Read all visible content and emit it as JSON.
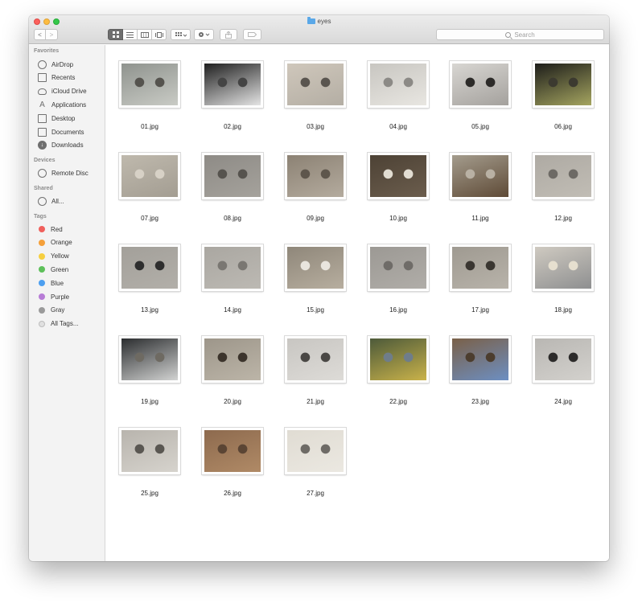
{
  "window": {
    "title": "eyes"
  },
  "toolbar": {
    "back_label": "<",
    "forward_label": ">",
    "search_placeholder": "Search"
  },
  "sidebar": {
    "favorites_heading": "Favorites",
    "favorites": [
      {
        "label": "AirDrop",
        "icon": "airdrop-icon"
      },
      {
        "label": "Recents",
        "icon": "recents-icon"
      },
      {
        "label": "iCloud Drive",
        "icon": "cloud-icon"
      },
      {
        "label": "Applications",
        "icon": "applications-icon"
      },
      {
        "label": "Desktop",
        "icon": "desktop-icon"
      },
      {
        "label": "Documents",
        "icon": "documents-icon"
      },
      {
        "label": "Downloads",
        "icon": "downloads-icon"
      }
    ],
    "devices_heading": "Devices",
    "devices": [
      {
        "label": "Remote Disc",
        "icon": "disc-icon"
      }
    ],
    "shared_heading": "Shared",
    "shared": [
      {
        "label": "All...",
        "icon": "globe-icon"
      }
    ],
    "tags_heading": "Tags",
    "tags": [
      {
        "label": "Red",
        "color": "#f0605c"
      },
      {
        "label": "Orange",
        "color": "#f5a03a"
      },
      {
        "label": "Yellow",
        "color": "#f6cf40"
      },
      {
        "label": "Green",
        "color": "#5dc05a"
      },
      {
        "label": "Blue",
        "color": "#4d9ff0"
      },
      {
        "label": "Purple",
        "color": "#b77cd6"
      },
      {
        "label": "Gray",
        "color": "#9a9a9a"
      },
      {
        "label": "All Tags...",
        "color": "#e0e0e0"
      }
    ]
  },
  "files": [
    {
      "name": "01.jpg",
      "colors": [
        "#8f938e",
        "#c9cbc5",
        "#55534e"
      ]
    },
    {
      "name": "02.jpg",
      "colors": [
        "#1f1f1f",
        "#e4e4e4",
        "#444"
      ]
    },
    {
      "name": "03.jpg",
      "colors": [
        "#cfc7bb",
        "#b4aea4",
        "#5a554f"
      ]
    },
    {
      "name": "04.jpg",
      "colors": [
        "#c8c6c1",
        "#e8e6e1",
        "#8c8a86"
      ]
    },
    {
      "name": "05.jpg",
      "colors": [
        "#d8d6d2",
        "#a4a19d",
        "#2d2b29"
      ]
    },
    {
      "name": "06.jpg",
      "colors": [
        "#1d1d1a",
        "#a5a560",
        "#3c3a30"
      ]
    },
    {
      "name": "07.jpg",
      "colors": [
        "#bfb9ad",
        "#a39d92",
        "#d7d1c6"
      ]
    },
    {
      "name": "08.jpg",
      "colors": [
        "#8e8b86",
        "#a5a29c",
        "#56534e"
      ]
    },
    {
      "name": "09.jpg",
      "colors": [
        "#8c8274",
        "#b4ab9e",
        "#5e564c"
      ]
    },
    {
      "name": "10.jpg",
      "colors": [
        "#4d4235",
        "#6b5d4d",
        "#e2ddd2"
      ]
    },
    {
      "name": "11.jpg",
      "colors": [
        "#a49c8d",
        "#5e4a36",
        "#b9b1a4"
      ]
    },
    {
      "name": "12.jpg",
      "colors": [
        "#aeaaa3",
        "#c1bdb5",
        "#6d6a65"
      ]
    },
    {
      "name": "13.jpg",
      "colors": [
        "#a3a09a",
        "#b2afa9",
        "#2e2e2e"
      ]
    },
    {
      "name": "14.jpg",
      "colors": [
        "#aaa7a1",
        "#bcb9b3",
        "#7a7772"
      ]
    },
    {
      "name": "15.jpg",
      "colors": [
        "#8f877a",
        "#b7ae9f",
        "#e9e5de"
      ]
    },
    {
      "name": "16.jpg",
      "colors": [
        "#9c9994",
        "#b0ada8",
        "#6f6c68"
      ]
    },
    {
      "name": "17.jpg",
      "colors": [
        "#9f9a91",
        "#b8b3aa",
        "#3a3631"
      ]
    },
    {
      "name": "18.jpg",
      "colors": [
        "#cfcac1",
        "#8e8f90",
        "#e6dfcf"
      ]
    },
    {
      "name": "19.jpg",
      "colors": [
        "#2b2d2f",
        "#d2d3d2",
        "#6e6a62"
      ]
    },
    {
      "name": "20.jpg",
      "colors": [
        "#9d968a",
        "#bcb5a8",
        "#3c342c"
      ]
    },
    {
      "name": "21.jpg",
      "colors": [
        "#c8c6c2",
        "#dddbd7",
        "#4a4845"
      ]
    },
    {
      "name": "22.jpg",
      "colors": [
        "#4d5a3a",
        "#c9b24a",
        "#6f7d8a"
      ]
    },
    {
      "name": "23.jpg",
      "colors": [
        "#7a6048",
        "#6d8fc2",
        "#4c3d2e"
      ]
    },
    {
      "name": "24.jpg",
      "colors": [
        "#b9b7b3",
        "#d3d1cd",
        "#2c2b2a"
      ]
    },
    {
      "name": "25.jpg",
      "colors": [
        "#b8b4ad",
        "#d6d3cd",
        "#5a5752"
      ]
    },
    {
      "name": "26.jpg",
      "colors": [
        "#8d6a4e",
        "#b08a66",
        "#5b4534"
      ]
    },
    {
      "name": "27.jpg",
      "colors": [
        "#e0dcd3",
        "#ebe8e1",
        "#6e6b66"
      ]
    }
  ]
}
